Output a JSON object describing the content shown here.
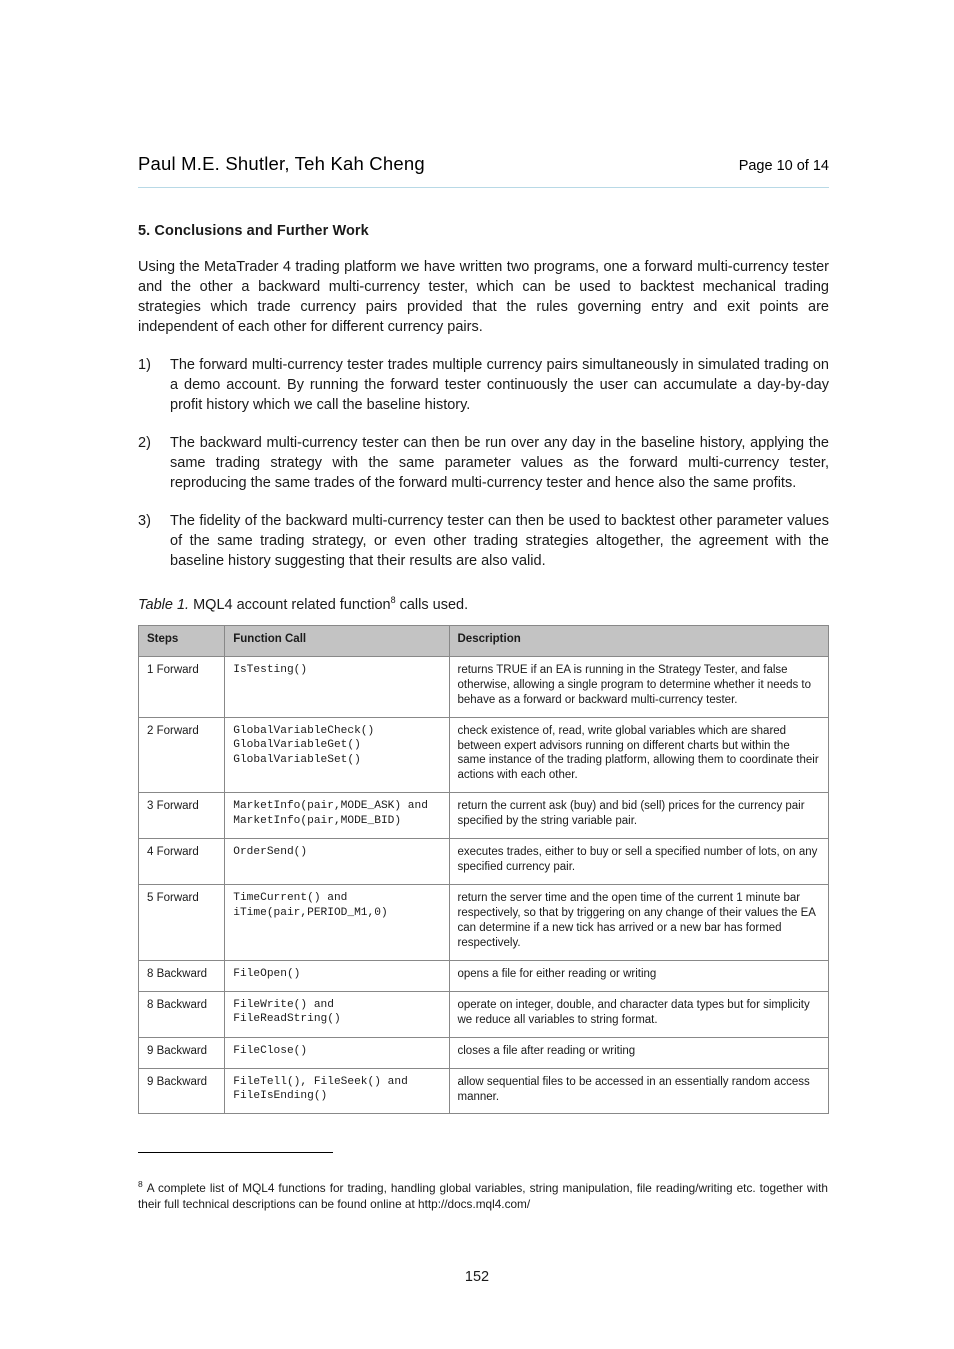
{
  "header": {
    "title": "Paul M.E. Shutler, Teh Kah Cheng",
    "page_label": "Page 10 of 14"
  },
  "section": {
    "num_title": "5. Conclusions and Further Work"
  },
  "paragraphs": {
    "intro": "Using the MetaTrader 4 trading platform we have written two programs, one a forward multi-currency tester and the other a backward multi-currency tester, which can be used to backtest mechanical trading strategies which trade currency pairs provided that the rules governing entry and exit points are independent of each other for different currency pairs.",
    "step1_num": "1)",
    "step1_text": "The forward multi-currency tester trades multiple currency pairs simultaneously in simulated trading on a demo account. By running the forward tester continuously the user can accumulate a day-by-day profit history which we call the baseline history.",
    "step2_num": "2)",
    "step2_text": "The backward multi-currency tester can then be run over any day in the baseline history, applying the same trading strategy with the same parameter values as the forward multi-currency tester, reproducing the same trades of the forward multi-currency tester and hence also the same profits.",
    "step3_num": "3)",
    "step3_text": "The fidelity of the backward multi-currency tester can then be used to backtest other parameter values of the same trading strategy, or even other trading strategies altogether, the agreement with the baseline history suggesting that their results are also valid."
  },
  "table_caption": {
    "label": "Table 1.",
    "text": " MQL4 account related function",
    "sup": "8",
    "tail": " calls used."
  },
  "table": {
    "headers": [
      "Steps",
      "Function Call",
      "Description"
    ],
    "rows": [
      {
        "step": "1 Forward",
        "call": "IsTesting()",
        "desc": "returns TRUE if an EA is running in the Strategy Tester, and false otherwise, allowing a single program to determine whether it needs to behave as a forward or backward multi-currency tester."
      },
      {
        "step": "2 Forward",
        "call": "GlobalVariableCheck()\nGlobalVariableGet()\nGlobalVariableSet()",
        "desc": "check existence of, read, write global variables which are shared between expert advisors running on different charts but within the same instance of the trading platform, allowing them to coordinate their actions with each other."
      },
      {
        "step": "3 Forward",
        "call": "MarketInfo(pair,MODE_ASK) and MarketInfo(pair,MODE_BID)",
        "desc": "return the current ask (buy) and bid (sell) prices for the currency pair specified by the string variable pair."
      },
      {
        "step": "4 Forward",
        "call": "OrderSend()",
        "desc": "executes trades, either to buy or sell a specified number of lots, on any specified currency pair."
      },
      {
        "step": "5 Forward",
        "call": "TimeCurrent() and iTime(pair,PERIOD_M1,0)",
        "desc": "return the server time and the open time of the current 1 minute bar respectively, so that by triggering on any change of their values the EA can determine if a new tick has arrived or a new bar has formed respectively."
      },
      {
        "step": "8 Backward",
        "call": "FileOpen()",
        "desc": "opens a file for either reading or writing"
      },
      {
        "step": "8 Backward",
        "call": "FileWrite() and FileReadString()",
        "desc": "operate on integer, double, and character data types but for simplicity we reduce all variables to string format."
      },
      {
        "step": "9 Backward",
        "call": "FileClose()",
        "desc": "closes a file after reading or writing"
      },
      {
        "step": "9 Backward",
        "call": "FileTell(), FileSeek() and FileIsEnding()",
        "desc": "allow sequential files to be accessed in an essentially random access manner."
      }
    ]
  },
  "footnote": {
    "num": "8",
    "text": "A complete list of MQL4 functions for trading, handling global variables, string manipulation, file reading/writing etc. together with their full technical descriptions can be found online at http://docs.mql4.com/"
  },
  "page_number": "152"
}
